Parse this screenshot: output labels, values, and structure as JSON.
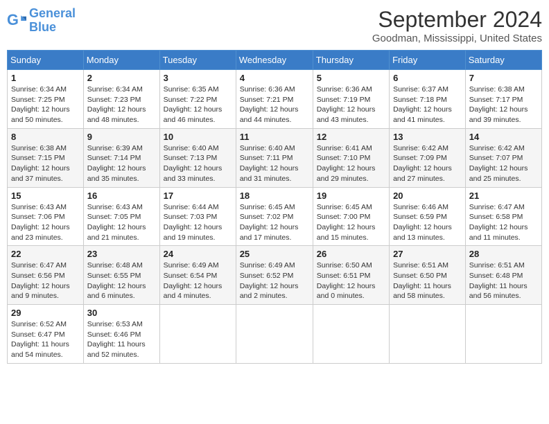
{
  "logo": {
    "line1": "General",
    "line2": "Blue"
  },
  "title": "September 2024",
  "subtitle": "Goodman, Mississippi, United States",
  "days_of_week": [
    "Sunday",
    "Monday",
    "Tuesday",
    "Wednesday",
    "Thursday",
    "Friday",
    "Saturday"
  ],
  "weeks": [
    [
      {
        "day": "1",
        "sunrise": "6:34 AM",
        "sunset": "7:25 PM",
        "daylight": "12 hours and 50 minutes."
      },
      {
        "day": "2",
        "sunrise": "6:34 AM",
        "sunset": "7:23 PM",
        "daylight": "12 hours and 48 minutes."
      },
      {
        "day": "3",
        "sunrise": "6:35 AM",
        "sunset": "7:22 PM",
        "daylight": "12 hours and 46 minutes."
      },
      {
        "day": "4",
        "sunrise": "6:36 AM",
        "sunset": "7:21 PM",
        "daylight": "12 hours and 44 minutes."
      },
      {
        "day": "5",
        "sunrise": "6:36 AM",
        "sunset": "7:19 PM",
        "daylight": "12 hours and 43 minutes."
      },
      {
        "day": "6",
        "sunrise": "6:37 AM",
        "sunset": "7:18 PM",
        "daylight": "12 hours and 41 minutes."
      },
      {
        "day": "7",
        "sunrise": "6:38 AM",
        "sunset": "7:17 PM",
        "daylight": "12 hours and 39 minutes."
      }
    ],
    [
      {
        "day": "8",
        "sunrise": "6:38 AM",
        "sunset": "7:15 PM",
        "daylight": "12 hours and 37 minutes."
      },
      {
        "day": "9",
        "sunrise": "6:39 AM",
        "sunset": "7:14 PM",
        "daylight": "12 hours and 35 minutes."
      },
      {
        "day": "10",
        "sunrise": "6:40 AM",
        "sunset": "7:13 PM",
        "daylight": "12 hours and 33 minutes."
      },
      {
        "day": "11",
        "sunrise": "6:40 AM",
        "sunset": "7:11 PM",
        "daylight": "12 hours and 31 minutes."
      },
      {
        "day": "12",
        "sunrise": "6:41 AM",
        "sunset": "7:10 PM",
        "daylight": "12 hours and 29 minutes."
      },
      {
        "day": "13",
        "sunrise": "6:42 AM",
        "sunset": "7:09 PM",
        "daylight": "12 hours and 27 minutes."
      },
      {
        "day": "14",
        "sunrise": "6:42 AM",
        "sunset": "7:07 PM",
        "daylight": "12 hours and 25 minutes."
      }
    ],
    [
      {
        "day": "15",
        "sunrise": "6:43 AM",
        "sunset": "7:06 PM",
        "daylight": "12 hours and 23 minutes."
      },
      {
        "day": "16",
        "sunrise": "6:43 AM",
        "sunset": "7:05 PM",
        "daylight": "12 hours and 21 minutes."
      },
      {
        "day": "17",
        "sunrise": "6:44 AM",
        "sunset": "7:03 PM",
        "daylight": "12 hours and 19 minutes."
      },
      {
        "day": "18",
        "sunrise": "6:45 AM",
        "sunset": "7:02 PM",
        "daylight": "12 hours and 17 minutes."
      },
      {
        "day": "19",
        "sunrise": "6:45 AM",
        "sunset": "7:00 PM",
        "daylight": "12 hours and 15 minutes."
      },
      {
        "day": "20",
        "sunrise": "6:46 AM",
        "sunset": "6:59 PM",
        "daylight": "12 hours and 13 minutes."
      },
      {
        "day": "21",
        "sunrise": "6:47 AM",
        "sunset": "6:58 PM",
        "daylight": "12 hours and 11 minutes."
      }
    ],
    [
      {
        "day": "22",
        "sunrise": "6:47 AM",
        "sunset": "6:56 PM",
        "daylight": "12 hours and 9 minutes."
      },
      {
        "day": "23",
        "sunrise": "6:48 AM",
        "sunset": "6:55 PM",
        "daylight": "12 hours and 6 minutes."
      },
      {
        "day": "24",
        "sunrise": "6:49 AM",
        "sunset": "6:54 PM",
        "daylight": "12 hours and 4 minutes."
      },
      {
        "day": "25",
        "sunrise": "6:49 AM",
        "sunset": "6:52 PM",
        "daylight": "12 hours and 2 minutes."
      },
      {
        "day": "26",
        "sunrise": "6:50 AM",
        "sunset": "6:51 PM",
        "daylight": "12 hours and 0 minutes."
      },
      {
        "day": "27",
        "sunrise": "6:51 AM",
        "sunset": "6:50 PM",
        "daylight": "11 hours and 58 minutes."
      },
      {
        "day": "28",
        "sunrise": "6:51 AM",
        "sunset": "6:48 PM",
        "daylight": "11 hours and 56 minutes."
      }
    ],
    [
      {
        "day": "29",
        "sunrise": "6:52 AM",
        "sunset": "6:47 PM",
        "daylight": "11 hours and 54 minutes."
      },
      {
        "day": "30",
        "sunrise": "6:53 AM",
        "sunset": "6:46 PM",
        "daylight": "11 hours and 52 minutes."
      },
      null,
      null,
      null,
      null,
      null
    ]
  ]
}
